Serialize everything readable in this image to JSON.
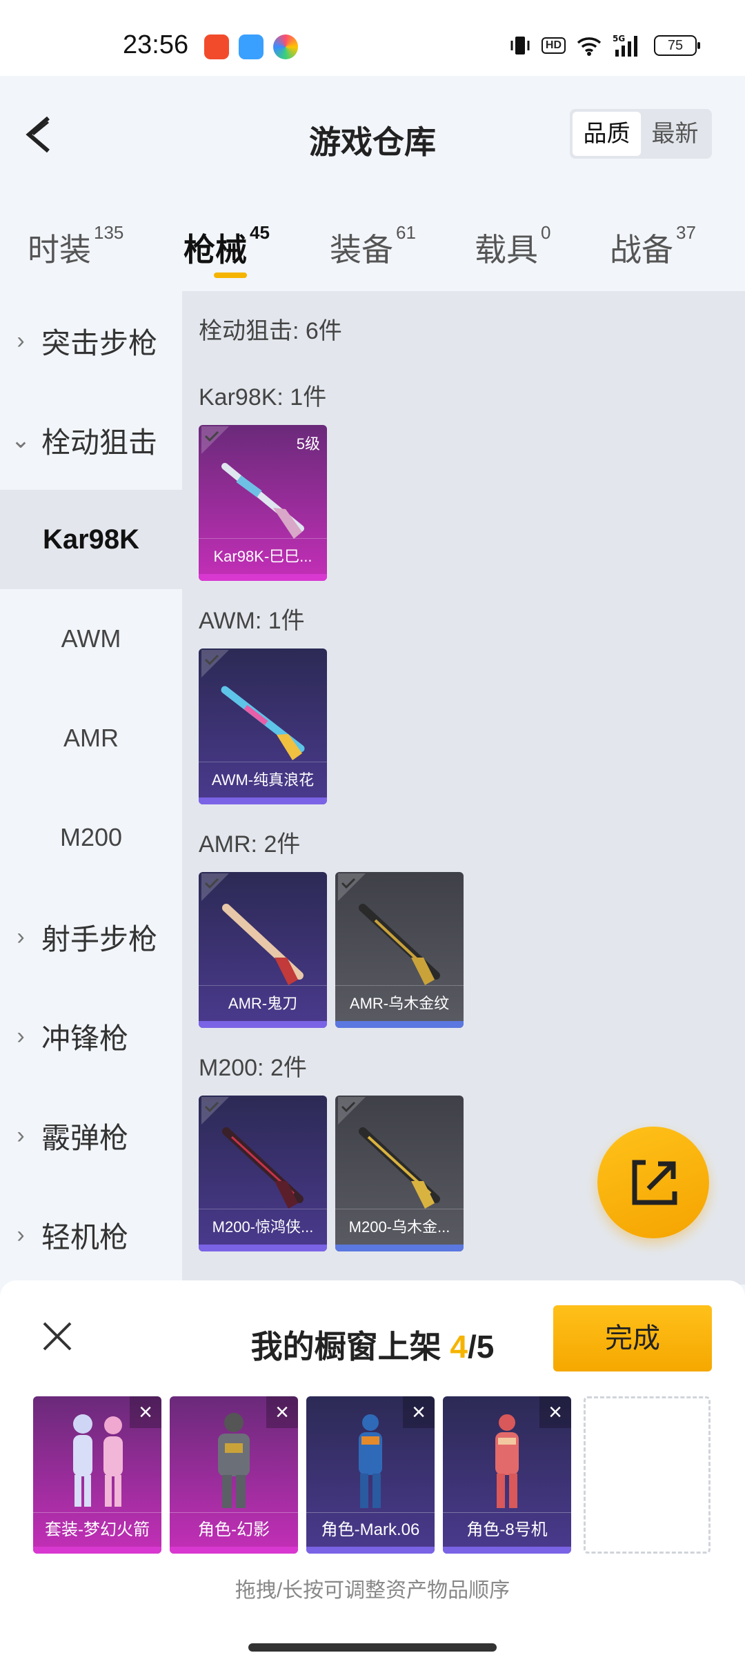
{
  "status_bar": {
    "time": "23:56",
    "battery": "75",
    "network": "5G",
    "hd": "HD"
  },
  "header": {
    "title": "游戏仓库",
    "sort_options": [
      "品质",
      "最新"
    ],
    "active_sort": "品质"
  },
  "tabs": [
    {
      "label": "时装",
      "count": "135"
    },
    {
      "label": "枪械",
      "count": "45"
    },
    {
      "label": "装备",
      "count": "61"
    },
    {
      "label": "载具",
      "count": "0"
    },
    {
      "label": "战备",
      "count": "37"
    }
  ],
  "active_tab": "枪械",
  "sidebar": {
    "items": [
      {
        "label": "突击步枪",
        "chevron": "right"
      },
      {
        "label": "栓动狙击",
        "chevron": "down"
      },
      {
        "label": "Kar98K",
        "sub": true,
        "active": true
      },
      {
        "label": "AWM",
        "sub": true
      },
      {
        "label": "AMR",
        "sub": true
      },
      {
        "label": "M200",
        "sub": true
      },
      {
        "label": "射手步枪",
        "chevron": "right"
      },
      {
        "label": "冲锋枪",
        "chevron": "right"
      },
      {
        "label": "霰弹枪",
        "chevron": "right"
      },
      {
        "label": "轻机枪",
        "chevron": "right"
      }
    ]
  },
  "main": {
    "category_summary": "栓动狙击: 6件",
    "groups": [
      {
        "title": "Kar98K: 1件",
        "items": [
          {
            "name": "Kar98K-巳巳...",
            "level": "5级",
            "rarity": "pink"
          }
        ]
      },
      {
        "title": "AWM: 1件",
        "items": [
          {
            "name": "AWM-纯真浪花",
            "rarity": "purple"
          }
        ]
      },
      {
        "title": "AMR: 2件",
        "items": [
          {
            "name": "AMR-鬼刀",
            "rarity": "purple"
          },
          {
            "name": "AMR-乌木金纹",
            "rarity": "grey"
          }
        ]
      },
      {
        "title": "M200: 2件",
        "items": [
          {
            "name": "M200-惊鸿侠...",
            "rarity": "purple"
          },
          {
            "name": "M200-乌木金...",
            "rarity": "grey"
          }
        ]
      }
    ]
  },
  "fab": {
    "icon": "share-external-icon"
  },
  "panel": {
    "title_prefix": "我的橱窗上架 ",
    "count": "4",
    "total": "/5",
    "done_label": "完成",
    "slots": [
      {
        "name": "套装-梦幻火箭",
        "rarity": "pink"
      },
      {
        "name": "角色-幻影",
        "rarity": "pink"
      },
      {
        "name": "角色-Mark.06",
        "rarity": "purple"
      },
      {
        "name": "角色-8号机",
        "rarity": "purple"
      }
    ],
    "hint": "拖拽/长按可调整资产物品顺序"
  },
  "colors": {
    "accent": "#f5b400",
    "pink_rarity": "#d838d0",
    "purple_rarity": "#7b63e6",
    "grey_rarity": "#5b78e0"
  }
}
